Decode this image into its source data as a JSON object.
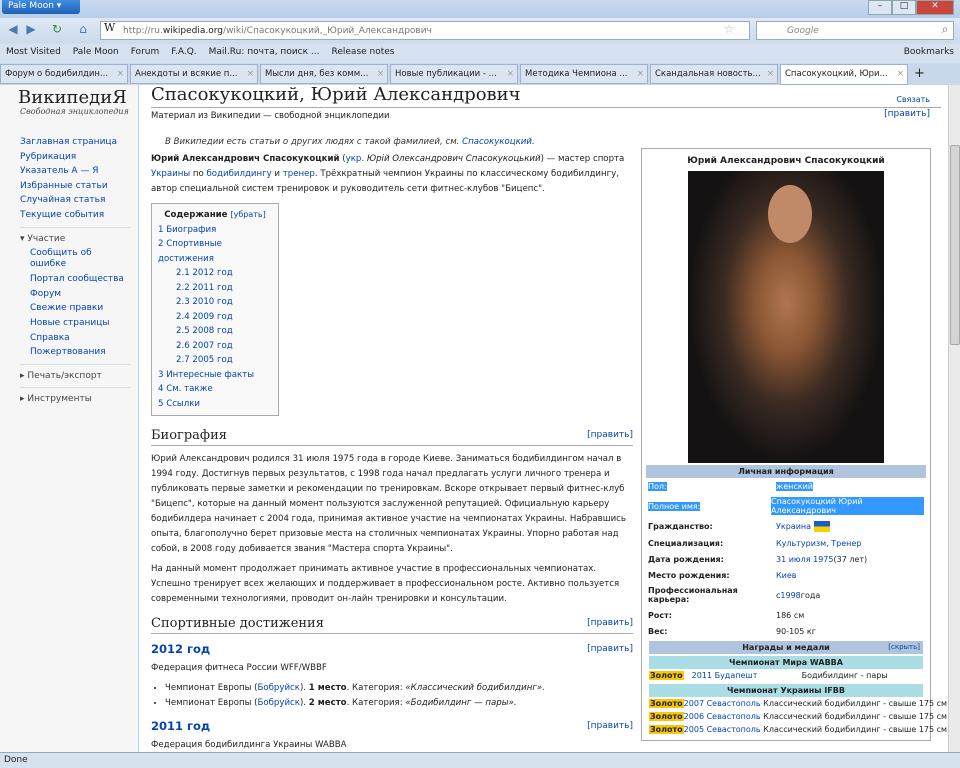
{
  "browser": {
    "app_button": "Pale Moon",
    "url_prefix": "http://ru.",
    "url_domain": "wikipedia.org",
    "url_path": "/wiki/Спасокукоцкий,_Юрий_Александрович",
    "search_placeholder": "Google",
    "status": "Done",
    "bookmarks": [
      "Most Visited",
      "Pale Moon",
      "Forum",
      "F.A.Q.",
      "Mail.Ru: почта, поиск ...",
      "Release notes"
    ],
    "bookmarks_menu": "Bookmarks",
    "tabs": [
      "Форум о бодибилдин...",
      "Анекдоты и всякие п...",
      "Мысли дня, без комм...",
      "Новые публикации - ...",
      "Методика Чемпиона ...",
      "Скандальная новость...",
      "Спасокукоцкий, Юри..."
    ]
  },
  "wiki": {
    "logo": "ВикипедиЯ",
    "logo_sub": "Свободная энциклопедия",
    "nav": [
      "Заглавная страница",
      "Рубрикация",
      "Указатель А — Я",
      "Избранные статьи",
      "Случайная статья",
      "Текущие события"
    ],
    "participation": "Участие",
    "participation_items": [
      "Сообщить об ошибке",
      "Портал сообщества",
      "Форум",
      "Свежие правки",
      "Новые страницы",
      "Справка",
      "Пожертвования"
    ],
    "print": "Печать/экспорт",
    "tools": "Инструменты"
  },
  "article": {
    "title": "Спасокукоцкий, Юрий Александрович",
    "link_langs": "Связать",
    "from": "Материал из Википедии — свободной энциклопедии",
    "edit": "[править]",
    "hatnote": "В Википедии есть статьи о других людях с такой фамилией, см. ",
    "hatnote_link": "Спасокукоцкий",
    "lead_bold": "Юрий Александрович Спасокукоцкий",
    "lead_ukr": "укр.",
    "lead_ukr_name": "Юрій Олександрович Спасокукоцький",
    "lead_1": " — мастер спорта ",
    "lead_l1": "Украины",
    "lead_2": " по ",
    "lead_l2": "бодибилдингу",
    "lead_3": " и ",
    "lead_l3": "тренер",
    "lead_4": ". Трёхкратный чемпион Украины по классическому бодибилдингу, автор специальной систем тренировок и руководитель сети фитнес-клубов \"Бицепс\".",
    "toc_title": "Содержание",
    "toc_hide": "[убрать]",
    "toc": [
      "1 Биография",
      "2 Спортивные достижения",
      "2.1 2012 год",
      "2.2 2011 год",
      "2.3 2010 год",
      "2.4 2009 год",
      "2.5 2008 год",
      "2.6 2007 год",
      "2.7 2005 год",
      "3 Интересные факты",
      "4 См. также",
      "5 Ссылки"
    ],
    "bio_heading": "Биография",
    "bio_p1": "Юрий Александрович родился 31 июля 1975 года в городе Киеве. Заниматься бодибилдингом начал в 1994 году. Достигнув первых результатов, с 1998 года начал предлагать услуги личного тренера и публиковать первые заметки и рекомендации по тренировкам. Вскоре открывает первый фитнес-клуб \"Бицепс\", которые на данный момент пользуются заслуженной репутацией. Официальную карьеру бодибилдера начинает с 2004 года, принимая активное участие на чемпионатах Украины. Набравшись опыта, благополучно берет призовые места на столичных чемпионатах Украины. Упорно работая над собой, в 2008 году добивается звания \"Мастера спорта Украины\".",
    "bio_p2": "На данный момент продолжает принимать активное участие в профессиональных чемпионатах. Успешно тренирует всех желающих и поддерживает в профессиональном росте. Активно пользуется современными технологиями, проводит он-лайн тренировки и консультации.",
    "sport_heading": "Спортивные достижения",
    "y2012": "2012 год",
    "y2012_fed": "Федерация фитнеса России WFF/WBBF",
    "y2012_items": [
      {
        "a": "Чемпионат Европы (",
        "link": "Бобруйск",
        "b": "). ",
        "place": "1 место",
        "c": ". Категория: ",
        "cat": "«Классический бодибилдинг»."
      },
      {
        "a": "Чемпионат Европы (",
        "link": "Бобруйск",
        "b": "). ",
        "place": "2 место",
        "c": ". Категория: ",
        "cat": "«Бодибилдинг — пары»."
      }
    ],
    "y2011": "2011 год",
    "y2011_fed": "Федерация бодибилдинга Украины WABBA"
  },
  "infobox": {
    "name": "Юрий Александрович Спасокукоцкий",
    "personal": "Личная информация",
    "rows": [
      {
        "k": "Пол:",
        "v": "женский"
      },
      {
        "k": "Полное имя:",
        "v": "Спасокукоцкий Юрий Александрович"
      },
      {
        "k": "Гражданство:",
        "v": "Украина"
      },
      {
        "k": "Специализация:",
        "v": "Культуризм, Тренер"
      },
      {
        "k": "Дата рождения:",
        "v": "31 июля 1975",
        "v2": " (37 лет)"
      },
      {
        "k": "Место рождения:",
        "v": "Киев"
      },
      {
        "k": "Профессиональная карьера:",
        "v0": "с ",
        "v": "1998",
        "v2": " года"
      },
      {
        "k": "Рост:",
        "v": "186 см"
      },
      {
        "k": "Вес:",
        "v": "90-105 кг"
      }
    ],
    "awards": "Награды и медали",
    "hide": "[скрыть]",
    "champ1": "Чемпионат Мира WABBA",
    "champ1_rows": [
      {
        "m": "Золото",
        "e": "2011 Будапешт",
        "c": "Бодибилдинг - пары"
      }
    ],
    "champ2": "Чемпионат Украины IFBB",
    "champ2_rows": [
      {
        "m": "Золото",
        "e": "2007 Севастополь",
        "c": "Классический бодибилдинг - свыше 175 см"
      },
      {
        "m": "Золото",
        "e": "2006 Севастополь",
        "c": "Классический бодибилдинг - свыше 175 см"
      },
      {
        "m": "Золото",
        "e": "2005 Севастополь",
        "c": "Классический бодибилдинг - свыше 175 см"
      }
    ]
  }
}
